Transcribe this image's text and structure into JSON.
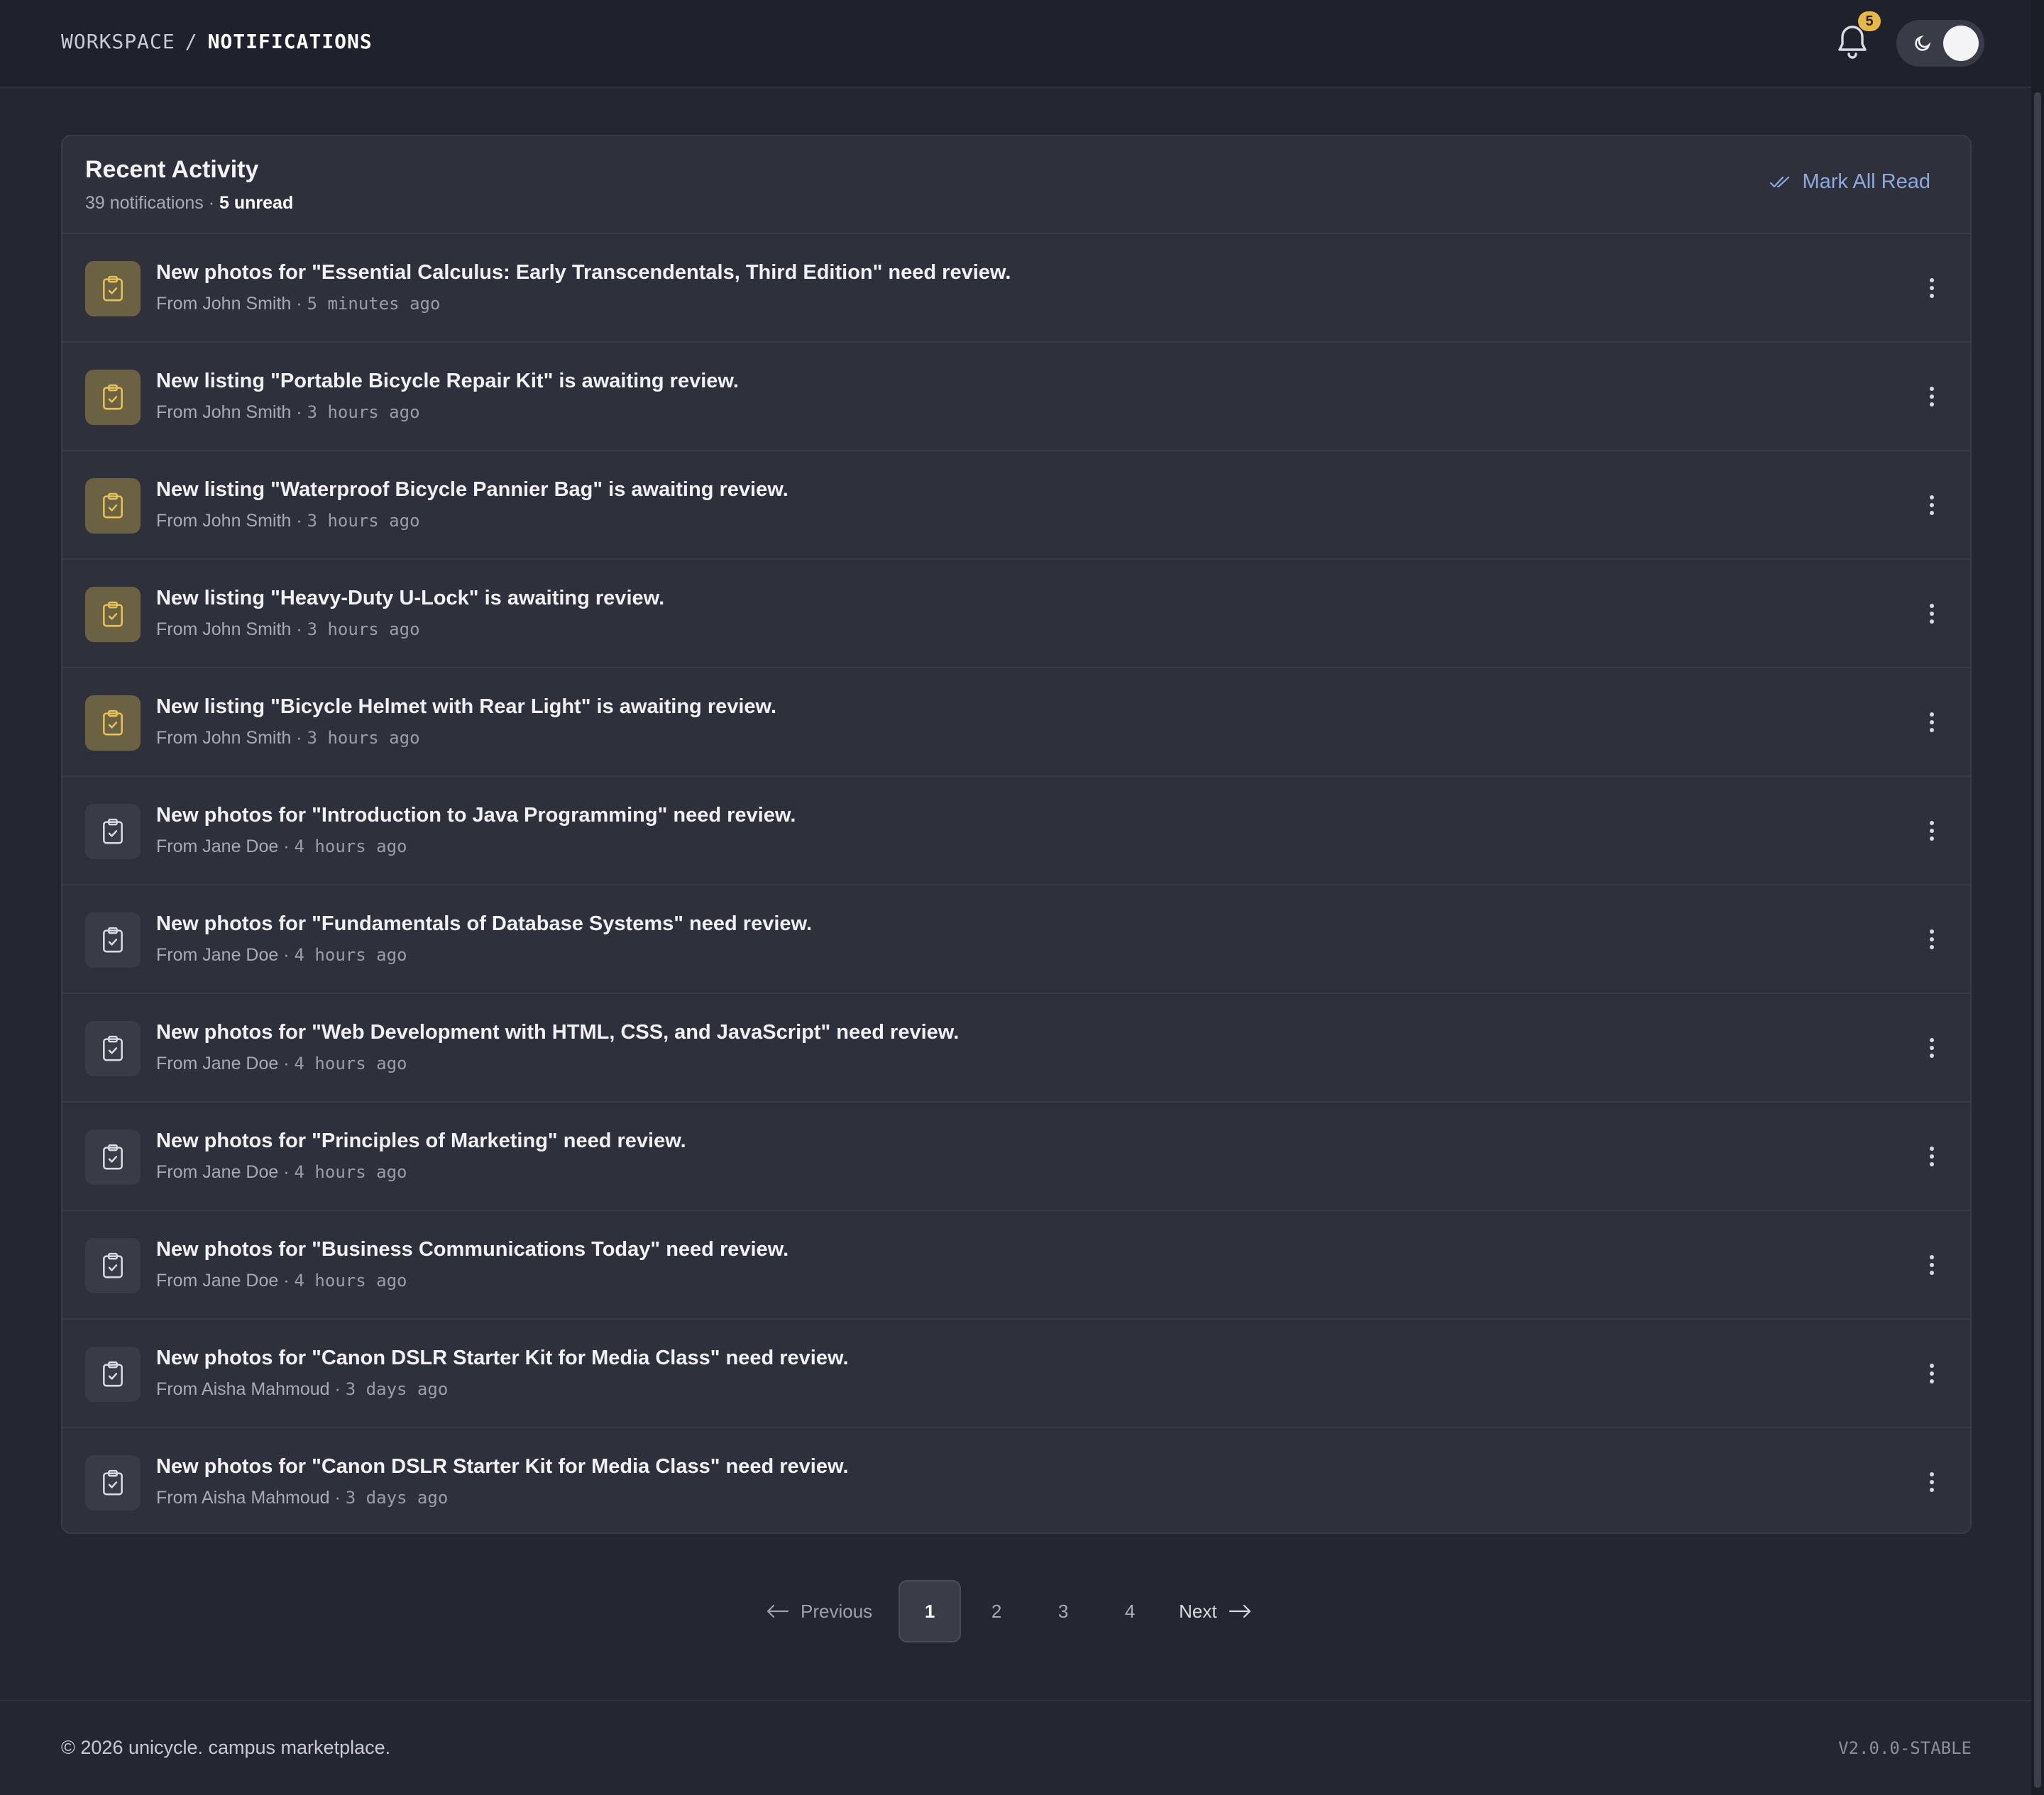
{
  "header": {
    "breadcrumb_root": "WORKSPACE",
    "breadcrumb_separator": "/",
    "breadcrumb_current": "NOTIFICATIONS",
    "bell_badge_count": "5"
  },
  "card": {
    "title": "Recent Activity",
    "notification_count": "39 notifications",
    "separator": "·",
    "unread_count": "5 unread",
    "mark_all_label": "Mark All Read"
  },
  "notifications": [
    {
      "title": "New photos for \"Essential Calculus: Early Transcendentals, Third Edition\" need review.",
      "from": "From John Smith",
      "time": "5 minutes ago",
      "unread": true
    },
    {
      "title": "New listing \"Portable Bicycle Repair Kit\" is awaiting review.",
      "from": "From John Smith",
      "time": "3 hours ago",
      "unread": true
    },
    {
      "title": "New listing \"Waterproof Bicycle Pannier Bag\" is awaiting review.",
      "from": "From John Smith",
      "time": "3 hours ago",
      "unread": true
    },
    {
      "title": "New listing \"Heavy-Duty U-Lock\" is awaiting review.",
      "from": "From John Smith",
      "time": "3 hours ago",
      "unread": true
    },
    {
      "title": "New listing \"Bicycle Helmet with Rear Light\" is awaiting review.",
      "from": "From John Smith",
      "time": "3 hours ago",
      "unread": true
    },
    {
      "title": "New photos for \"Introduction to Java Programming\" need review.",
      "from": "From Jane Doe",
      "time": "4 hours ago",
      "unread": false
    },
    {
      "title": "New photos for \"Fundamentals of Database Systems\" need review.",
      "from": "From Jane Doe",
      "time": "4 hours ago",
      "unread": false
    },
    {
      "title": "New photos for \"Web Development with HTML, CSS, and JavaScript\" need review.",
      "from": "From Jane Doe",
      "time": "4 hours ago",
      "unread": false
    },
    {
      "title": "New photos for \"Principles of Marketing\" need review.",
      "from": "From Jane Doe",
      "time": "4 hours ago",
      "unread": false
    },
    {
      "title": "New photos for \"Business Communications Today\" need review.",
      "from": "From Jane Doe",
      "time": "4 hours ago",
      "unread": false
    },
    {
      "title": "New photos for \"Canon DSLR Starter Kit for Media Class\" need review.",
      "from": "From Aisha Mahmoud",
      "time": "3 days ago",
      "unread": false
    },
    {
      "title": "New photos for \"Canon DSLR Starter Kit for Media Class\" need review.",
      "from": "From Aisha Mahmoud",
      "time": "3 days ago",
      "unread": false
    }
  ],
  "icons": {
    "notification": "clipboard-check-icon",
    "menu": "more-vertical-icon",
    "bell": "bell-icon",
    "theme": "moon-icon",
    "mark_all": "double-check-icon",
    "prev": "arrow-left-icon",
    "next": "arrow-right-icon"
  },
  "pagination": {
    "prev_label": "Previous",
    "next_label": "Next",
    "pages": [
      "1",
      "2",
      "3",
      "4"
    ],
    "current": "1"
  },
  "footer": {
    "copyright": "© 2026 unicycle. campus marketplace.",
    "version": "V2.0.0-STABLE"
  },
  "colors": {
    "background": "#242631",
    "header": "#1f212c",
    "card": "#2e303c",
    "accent_link": "#8fa8dc",
    "unread_icon_bg": "#6b6243",
    "unread_icon_fg": "#e6c35a",
    "badge": "#e6b84a"
  }
}
